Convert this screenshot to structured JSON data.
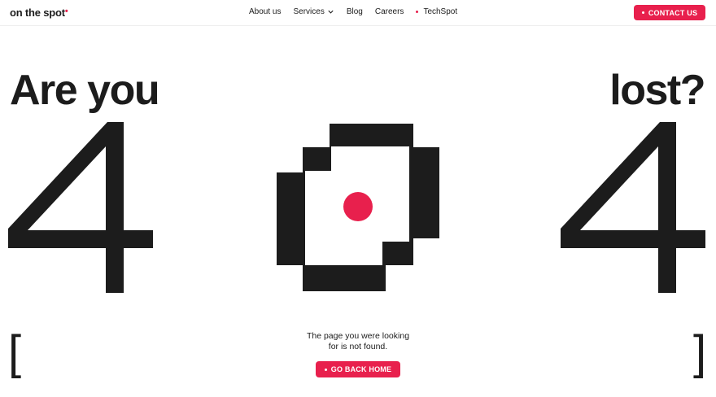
{
  "header": {
    "logo_text": "on the spot",
    "logo_mark": "•",
    "nav": [
      {
        "label": "About us"
      },
      {
        "label": "Services"
      },
      {
        "label": "Blog"
      },
      {
        "label": "Careers"
      },
      {
        "label": "TechSpot"
      }
    ],
    "contact_label": "CONTACT US"
  },
  "hero": {
    "headline_left": "Are you",
    "headline_right": "lost?",
    "error_code": "404"
  },
  "footer": {
    "bracket_left": "[",
    "bracket_right": "]",
    "message_line1": "The page you were looking",
    "message_line2": "for is not found.",
    "home_label": "GO BACK HOME"
  },
  "colors": {
    "accent": "#e8204d",
    "text": "#1c1c1c",
    "background": "#ffffff"
  },
  "icons": {
    "services_dropdown": "chevron-down-icon",
    "techspot_marker": "dot-icon",
    "zero_graphic": "pixel-ring-with-red-dot"
  }
}
